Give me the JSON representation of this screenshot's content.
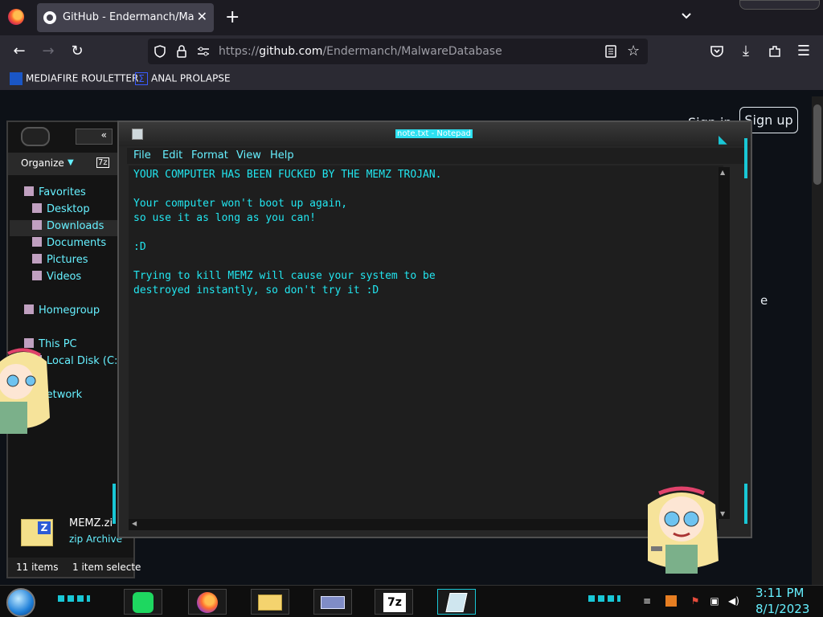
{
  "browser": {
    "tab": {
      "title": "GitHub - Endermanch/Malware"
    },
    "url": {
      "prefix": "https://",
      "host": "github.com",
      "path": "/Endermanch/MalwareDatabase"
    },
    "bookmarks": [
      {
        "label": "MEDIAFIRE ROULETTER",
        "icon": "mediafire-icon"
      },
      {
        "label": "ANAL PROLAPSE",
        "icon": "sigma-icon"
      }
    ]
  },
  "github": {
    "sign_in": "Sign in",
    "sign_up": "Sign up",
    "side_fragment": "e"
  },
  "explorer": {
    "organize": "Organize",
    "back_label": "«",
    "nav": [
      {
        "label": "Favorites"
      },
      {
        "label": "Desktop"
      },
      {
        "label": "Downloads"
      },
      {
        "label": "Documents"
      },
      {
        "label": "Pictures"
      },
      {
        "label": "Videos"
      },
      {
        "label": "Homegroup"
      },
      {
        "label": "This PC"
      },
      {
        "label": "Local Disk (C:"
      },
      {
        "label": "letwork"
      }
    ],
    "file": {
      "name": "MEMZ.zi",
      "type": "zip Archive"
    },
    "status": {
      "items": "11 items",
      "selected": "1 item selecte"
    }
  },
  "notepad": {
    "title": "note.txt - Notepad",
    "menu": [
      "File",
      "Edit",
      "Format",
      "View",
      "Help"
    ],
    "lines": [
      "YOUR COMPUTER HAS BEEN FUCKED BY THE MEMZ TROJAN.",
      "",
      "Your computer won't boot up again,",
      "so use it as long as you can!",
      "",
      ":D",
      "",
      "Trying to kill MEMZ will cause your system to be",
      "destroyed instantly, so don't try it :D"
    ]
  },
  "taskbar": {
    "apps": [
      {
        "name": "spotify"
      },
      {
        "name": "firefox"
      },
      {
        "name": "file-explorer"
      },
      {
        "name": "card-app"
      },
      {
        "name": "7zip",
        "label": "7z"
      },
      {
        "name": "notepad"
      }
    ],
    "clock": {
      "time": "3:11 PM",
      "date": "8/1/2023"
    }
  },
  "colors": {
    "accent": "#19c7d6",
    "text": "#22e6f0"
  }
}
